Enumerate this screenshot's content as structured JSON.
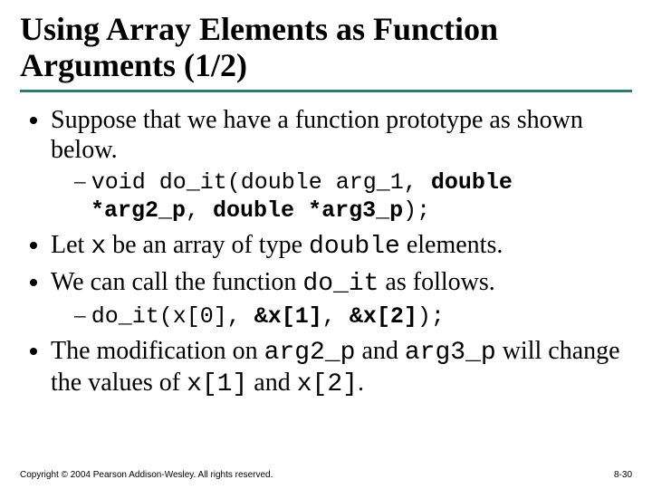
{
  "title": "Using Array Elements as Function Arguments (1/2)",
  "bullets": {
    "b1": "Suppose that we have a function prototype as shown below.",
    "proto": {
      "p1": "void do_it(double arg_1, ",
      "p2": "double *arg2_p",
      "p3": ", ",
      "p4": "double *arg3_p",
      "p5": ");"
    },
    "b2a": "Let ",
    "b2x": "x",
    "b2b": " be an array of type ",
    "b2d": "double",
    "b2c": " elements.",
    "b3a": "We can call the function ",
    "b3f": "do_it",
    "b3b": " as follows.",
    "call": {
      "c1": "do_it(x[0], ",
      "c2": "&x[1]",
      "c3": ", ",
      "c4": "&x[2]",
      "c5": ");"
    },
    "b4a": "The modification on ",
    "b4arg2": "arg2_p",
    "b4b": " and ",
    "b4arg3": "arg3_p",
    "b4c": " will change the values of ",
    "b4x1": "x[1]",
    "b4d": " and ",
    "b4x2": "x[2]",
    "b4e": "."
  },
  "footer": {
    "copyright": "Copyright © 2004 Pearson Addison-Wesley. All rights reserved.",
    "pagenum": "8-30"
  }
}
